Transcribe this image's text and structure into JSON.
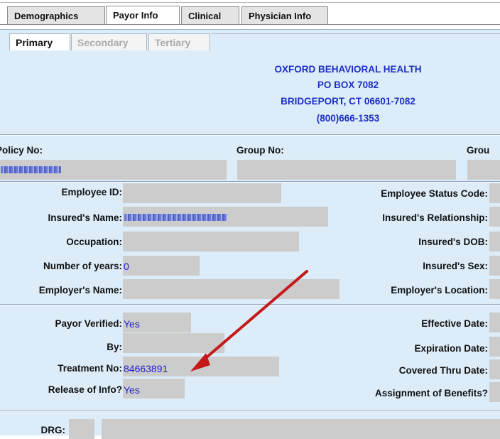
{
  "tabs": [
    "Demographics",
    "Payor Info",
    "Clinical",
    "Physician Info"
  ],
  "subtabs": [
    "Primary",
    "Secondary",
    "Tertiary"
  ],
  "payor": {
    "name": "OXFORD BEHAVIORAL HEALTH",
    "address1": "PO BOX 7082",
    "address2": "BRIDGEPORT, CT  06601-7082",
    "phone": "(800)666-1353"
  },
  "policy": {
    "policy_no_label": "Policy No:",
    "group_no_label": "Group No:",
    "group_truncated_label": "Grou"
  },
  "employee": {
    "employee_id_label": "Employee ID:",
    "insured_name_label": "Insured's Name:",
    "occupation_label": "Occupation:",
    "years_label": "Number of years:",
    "years_value": "0",
    "employer_name_label": "Employer's Name:",
    "status_code_label": "Employee Status Code:",
    "relationship_label": "Insured's Relationship:",
    "dob_label": "Insured's DOB:",
    "sex_label": "Insured's Sex:",
    "employer_location_label": "Employer's Location:"
  },
  "verification": {
    "payor_verified_label": "Payor Verified:",
    "payor_verified_value": "Yes",
    "by_label": "By:",
    "treatment_no_label": "Treatment No:",
    "treatment_no_value": "84663891",
    "release_label": "Release of Info?",
    "release_value": "Yes",
    "effective_date_label": "Effective Date:",
    "expiration_date_label": "Expiration Date:",
    "covered_thru_label": "Covered Thru Date:",
    "assignment_label": "Assignment of Benefits?"
  },
  "drg": {
    "label": "DRG:"
  },
  "colors": {
    "panel_bg": "#dcecf8",
    "field_bg": "#cccccc",
    "payor_text": "#1c2fc4",
    "value_text": "#2020c8",
    "arrow": "#c41a1a"
  }
}
